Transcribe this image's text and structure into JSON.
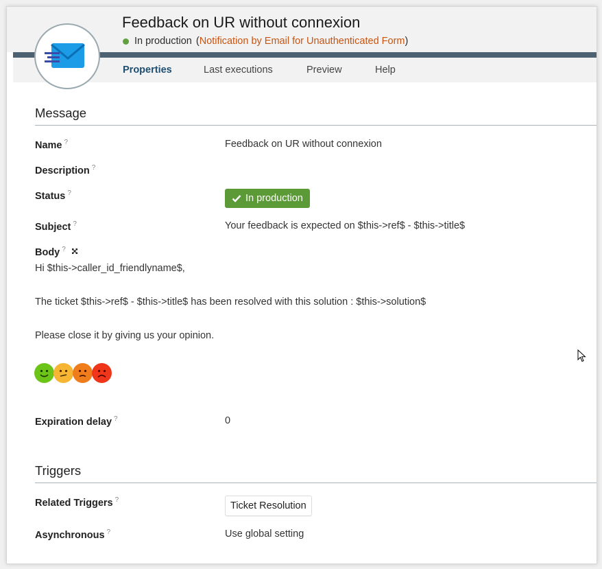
{
  "header": {
    "title": "Feedback on UR without connexion",
    "status": "In production",
    "type_open": "(",
    "type_label": "Notification by Email for Unauthenticated Form",
    "type_close": ")"
  },
  "tabs": [
    {
      "label": "Properties",
      "active": true
    },
    {
      "label": "Last executions"
    },
    {
      "label": "Preview"
    },
    {
      "label": "Help"
    }
  ],
  "message": {
    "section_title": "Message",
    "name_label": "Name",
    "name_value": "Feedback on UR without connexion",
    "description_label": "Description",
    "status_label": "Status",
    "status_value": "In production",
    "subject_label": "Subject",
    "subject_value": "Your feedback is expected on $this->ref$ - $this->title$",
    "body_label": "Body",
    "body_lines": [
      "Hi $this->caller_id_friendlyname$,",
      "The ticket $this->ref$ - $this->title$ has been resolved with this solution : $this->solution$",
      "Please close it by giving us your opinion."
    ],
    "expiration_label": "Expiration delay",
    "expiration_value": "0",
    "help_marker": "?"
  },
  "triggers": {
    "section_title": "Triggers",
    "related_label": "Related Triggers",
    "related_value": "Ticket Resolution",
    "async_label": "Asynchronous",
    "async_value": "Use global setting"
  },
  "colors": {
    "accent": "#1e4f73",
    "status_green": "#5b9a36",
    "link_orange": "#c8540f",
    "smiley_green": "#6cc418",
    "smiley_yellow": "#f6b532",
    "smiley_orange": "#f07d1c",
    "smiley_red": "#f0361a"
  },
  "icons": [
    "email-icon",
    "help-icon",
    "expand-icon",
    "check-icon",
    "smiley-happy-icon",
    "smiley-neutral-icon",
    "smiley-unhappy-icon",
    "smiley-sad-icon",
    "mouse-cursor-icon"
  ]
}
